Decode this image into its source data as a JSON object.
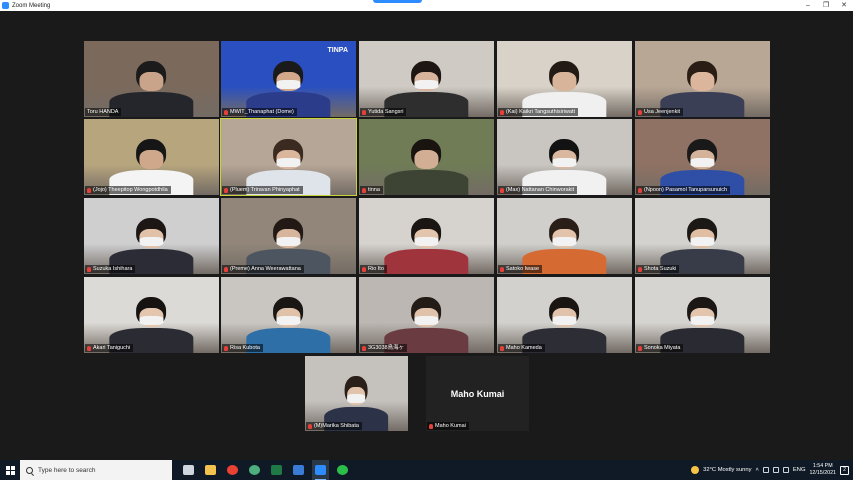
{
  "window": {
    "title": "Zoom Meeting"
  },
  "participants": [
    {
      "name": "Toru HANDA",
      "mic_icon": false,
      "bg": "#7b6a5c",
      "skin": "#c9a48a",
      "hair": "#1b1b1b",
      "mask": false,
      "shirt": "#25262c"
    },
    {
      "name": "MWIT_Thanaphat (Dome)",
      "mic_icon": true,
      "bg": "#2a4fc0",
      "skin": "#d3a88b",
      "hair": "#1a1a1a",
      "mask": true,
      "shirt": "#2b3c8a",
      "logo": "TINPA"
    },
    {
      "name": "Yutida Sangsri",
      "mic_icon": true,
      "bg": "#cfcac4",
      "skin": "#d9b49c",
      "hair": "#1e1612",
      "mask": true,
      "shirt": "#2e2e2e"
    },
    {
      "name": "(Kai) Kaikri Tangsuthisiriwatt",
      "mic_icon": true,
      "bg": "#d8d2c8",
      "skin": "#d8b49a",
      "hair": "#231a15",
      "mask": false,
      "shirt": "#f0f0f0"
    },
    {
      "name": "Usa Jeenjenkit",
      "mic_icon": true,
      "bg": "#b9a795",
      "skin": "#dcb69c",
      "hair": "#2a1d16",
      "mask": false,
      "shirt": "#3a3f55"
    },
    {
      "name": "(Jojo) Theepitop Wongpotdhila",
      "mic_icon": true,
      "bg": "#b7a57e",
      "skin": "#cfa88b",
      "hair": "#161616",
      "mask": false,
      "shirt": "#f4f4f4"
    },
    {
      "name": "(Pluem) Triravan Phinyaphat",
      "mic_icon": true,
      "bg": "#b6a697",
      "skin": "#dab69d",
      "hair": "#3b2a1f",
      "mask": true,
      "shirt": "#dfe4ea",
      "active": true
    },
    {
      "name": "tinna",
      "mic_icon": true,
      "bg": "#6f7c56",
      "skin": "#d2ae94",
      "hair": "#1a1410",
      "mask": false,
      "shirt": "#3e4433"
    },
    {
      "name": "(Max) Nattanan Chinworakit",
      "mic_icon": true,
      "bg": "#c9c6c1",
      "skin": "#dab79f",
      "hair": "#121212",
      "mask": true,
      "shirt": "#f1f1f1"
    },
    {
      "name": "(Npoon) Pasamol Tanuparsunuich",
      "mic_icon": true,
      "bg": "#8f7263",
      "skin": "#d5b29a",
      "hair": "#191919",
      "mask": true,
      "shirt": "#2f4fa6"
    },
    {
      "name": "Suzuka Ishihara",
      "mic_icon": true,
      "bg": "#cfcfd0",
      "skin": "#e1c1a8",
      "hair": "#1c1715",
      "mask": true,
      "shirt": "#2c2c36"
    },
    {
      "name": "(Preme) Anna Weerawattana",
      "mic_icon": true,
      "bg": "#918679",
      "skin": "#d7b49c",
      "hair": "#221914",
      "mask": true,
      "shirt": "#4d5560"
    },
    {
      "name": "Rio Ito",
      "mic_icon": true,
      "bg": "#d6d3cf",
      "skin": "#e3c4ac",
      "hair": "#1a1512",
      "mask": true,
      "shirt": "#a0343c"
    },
    {
      "name": "Satoko Iwase",
      "mic_icon": true,
      "bg": "#d0cfcb",
      "skin": "#e2c3ab",
      "hair": "#2a1f18",
      "mask": true,
      "shirt": "#d56a33"
    },
    {
      "name": "Shota Suzuki",
      "mic_icon": true,
      "bg": "#d3d2cf",
      "skin": "#e0bea4",
      "hair": "#1c1816",
      "mask": true,
      "shirt": "#383b48"
    },
    {
      "name": "Akari Taniguchi",
      "mic_icon": true,
      "bg": "#dcdad6",
      "skin": "#e4c6af",
      "hair": "#161310",
      "mask": true,
      "shirt": "#2b2b33"
    },
    {
      "name": "Risa Kubota",
      "mic_icon": true,
      "bg": "#c9c6c2",
      "skin": "#e0c2aa",
      "hair": "#1a1613",
      "mask": true,
      "shirt": "#2e6fa8"
    },
    {
      "name": "3G3038鳥海ヶ",
      "mic_icon": true,
      "bg": "#bcb7b2",
      "skin": "#e0c2aa",
      "hair": "#231b16",
      "mask": true,
      "shirt": "#6a3b40"
    },
    {
      "name": "Maho Kameda",
      "mic_icon": true,
      "bg": "#d2d1cd",
      "skin": "#e1c3ab",
      "hair": "#1a1512",
      "mask": true,
      "shirt": "#2d2d36"
    },
    {
      "name": "Sonoka Miyata",
      "mic_icon": true,
      "bg": "#d6d4d0",
      "skin": "#e3c5ae",
      "hair": "#1b1714",
      "mask": true,
      "shirt": "#2a2a32"
    },
    {
      "name": "(M)Marika Shibata",
      "mic_icon": true,
      "bg": "#c5c2be",
      "skin": "#e2c4ad",
      "hair": "#2b2019",
      "mask": true,
      "shirt": "#2c3348"
    },
    {
      "name": "Maho Kumai",
      "mic_icon": true,
      "blank": true,
      "big_name": "Maho Kumai"
    }
  ],
  "taskbar": {
    "search_placeholder": "Type here to search",
    "apps": [
      {
        "name": "task-view",
        "color": "#cfd6de"
      },
      {
        "name": "file-explorer",
        "color": "#f2c14e"
      },
      {
        "name": "chrome",
        "color": "#e94235"
      },
      {
        "name": "edge",
        "color": "#4caf7d"
      },
      {
        "name": "excel",
        "color": "#1f7a45"
      },
      {
        "name": "photos",
        "color": "#3a7bd5"
      },
      {
        "name": "zoom",
        "color": "#2d8cff",
        "active": true
      },
      {
        "name": "line",
        "color": "#2bbf4a"
      }
    ],
    "weather": "32°C  Mostly sunny",
    "lang": "ENG",
    "time": "1:54 PM",
    "date": "12/15/2021",
    "notifications": "2"
  }
}
